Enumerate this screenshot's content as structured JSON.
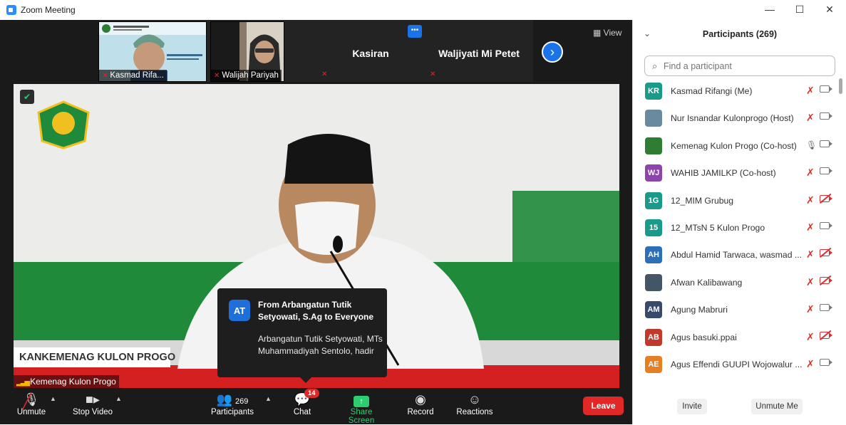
{
  "window": {
    "title": "Zoom Meeting",
    "controls": {
      "minimize": "—",
      "maximize": "☐",
      "close": "✕"
    }
  },
  "gallery": {
    "thumbnails": [
      {
        "name": "Kasmad Rifa..."
      },
      {
        "name": "Walijah Pariyah"
      },
      {
        "name": "Kasiran"
      },
      {
        "name": "Waljiyati Mi Petet"
      }
    ],
    "view_label": "View"
  },
  "main_video": {
    "lower_third": "KANKEMENAG KULON PROGO",
    "speaker": "Kemenag Kulon Progo"
  },
  "chat_popup": {
    "avatar": "AT",
    "from": "From Arbangatun Tutik Setyowati, S.Ag to Everyone",
    "message": "Arbangatun Tutik Setyowati, MTs Muhammadiyah Sentolo, hadir"
  },
  "toolbar": {
    "unmute": "Unmute",
    "stop_video": "Stop Video",
    "participants": "Participants",
    "participants_count": "269",
    "chat": "Chat",
    "chat_badge": "14",
    "share_screen": "Share Screen",
    "record": "Record",
    "reactions": "Reactions",
    "leave": "Leave"
  },
  "panel": {
    "title": "Participants (269)",
    "search_placeholder": "Find a participant",
    "participants": [
      {
        "initials": "KR",
        "name": "Kasmad Rifangi (Me)",
        "color": "#1a9a8a",
        "mic": "muted",
        "cam": "on"
      },
      {
        "initials": "",
        "name": "Nur Isnandar Kulonprogo (Host)",
        "color": "#6a8aa0",
        "mic": "muted",
        "cam": "on"
      },
      {
        "initials": "",
        "name": "Kemenag Kulon Progo (Co-host)",
        "color": "#2e7d32",
        "mic": "on",
        "cam": "on"
      },
      {
        "initials": "WJ",
        "name": "WAHIB JAMILKP (Co-host)",
        "color": "#8e44ad",
        "mic": "muted",
        "cam": "on"
      },
      {
        "initials": "1G",
        "name": "12_MIM Grubug",
        "color": "#1a9a8a",
        "mic": "muted",
        "cam": "off"
      },
      {
        "initials": "15",
        "name": "12_MTsN 5 Kulon Progo",
        "color": "#1a9a8a",
        "mic": "muted",
        "cam": "on"
      },
      {
        "initials": "AH",
        "name": "Abdul Hamid Tarwaca, wasmad ...",
        "color": "#2a6fb8",
        "mic": "muted",
        "cam": "off"
      },
      {
        "initials": "",
        "name": "Afwan Kalibawang",
        "color": "#445566",
        "mic": "muted",
        "cam": "off"
      },
      {
        "initials": "AM",
        "name": "Agung Mabruri",
        "color": "#3a4a6a",
        "mic": "muted",
        "cam": "on"
      },
      {
        "initials": "AB",
        "name": "Agus basuki.ppai",
        "color": "#c0392b",
        "mic": "muted",
        "cam": "off"
      },
      {
        "initials": "AE",
        "name": "Agus Effendi GUUPI Wojowalur ...",
        "color": "#e67e22",
        "mic": "muted",
        "cam": "on"
      }
    ],
    "invite": "Invite",
    "unmute_me": "Unmute Me"
  }
}
